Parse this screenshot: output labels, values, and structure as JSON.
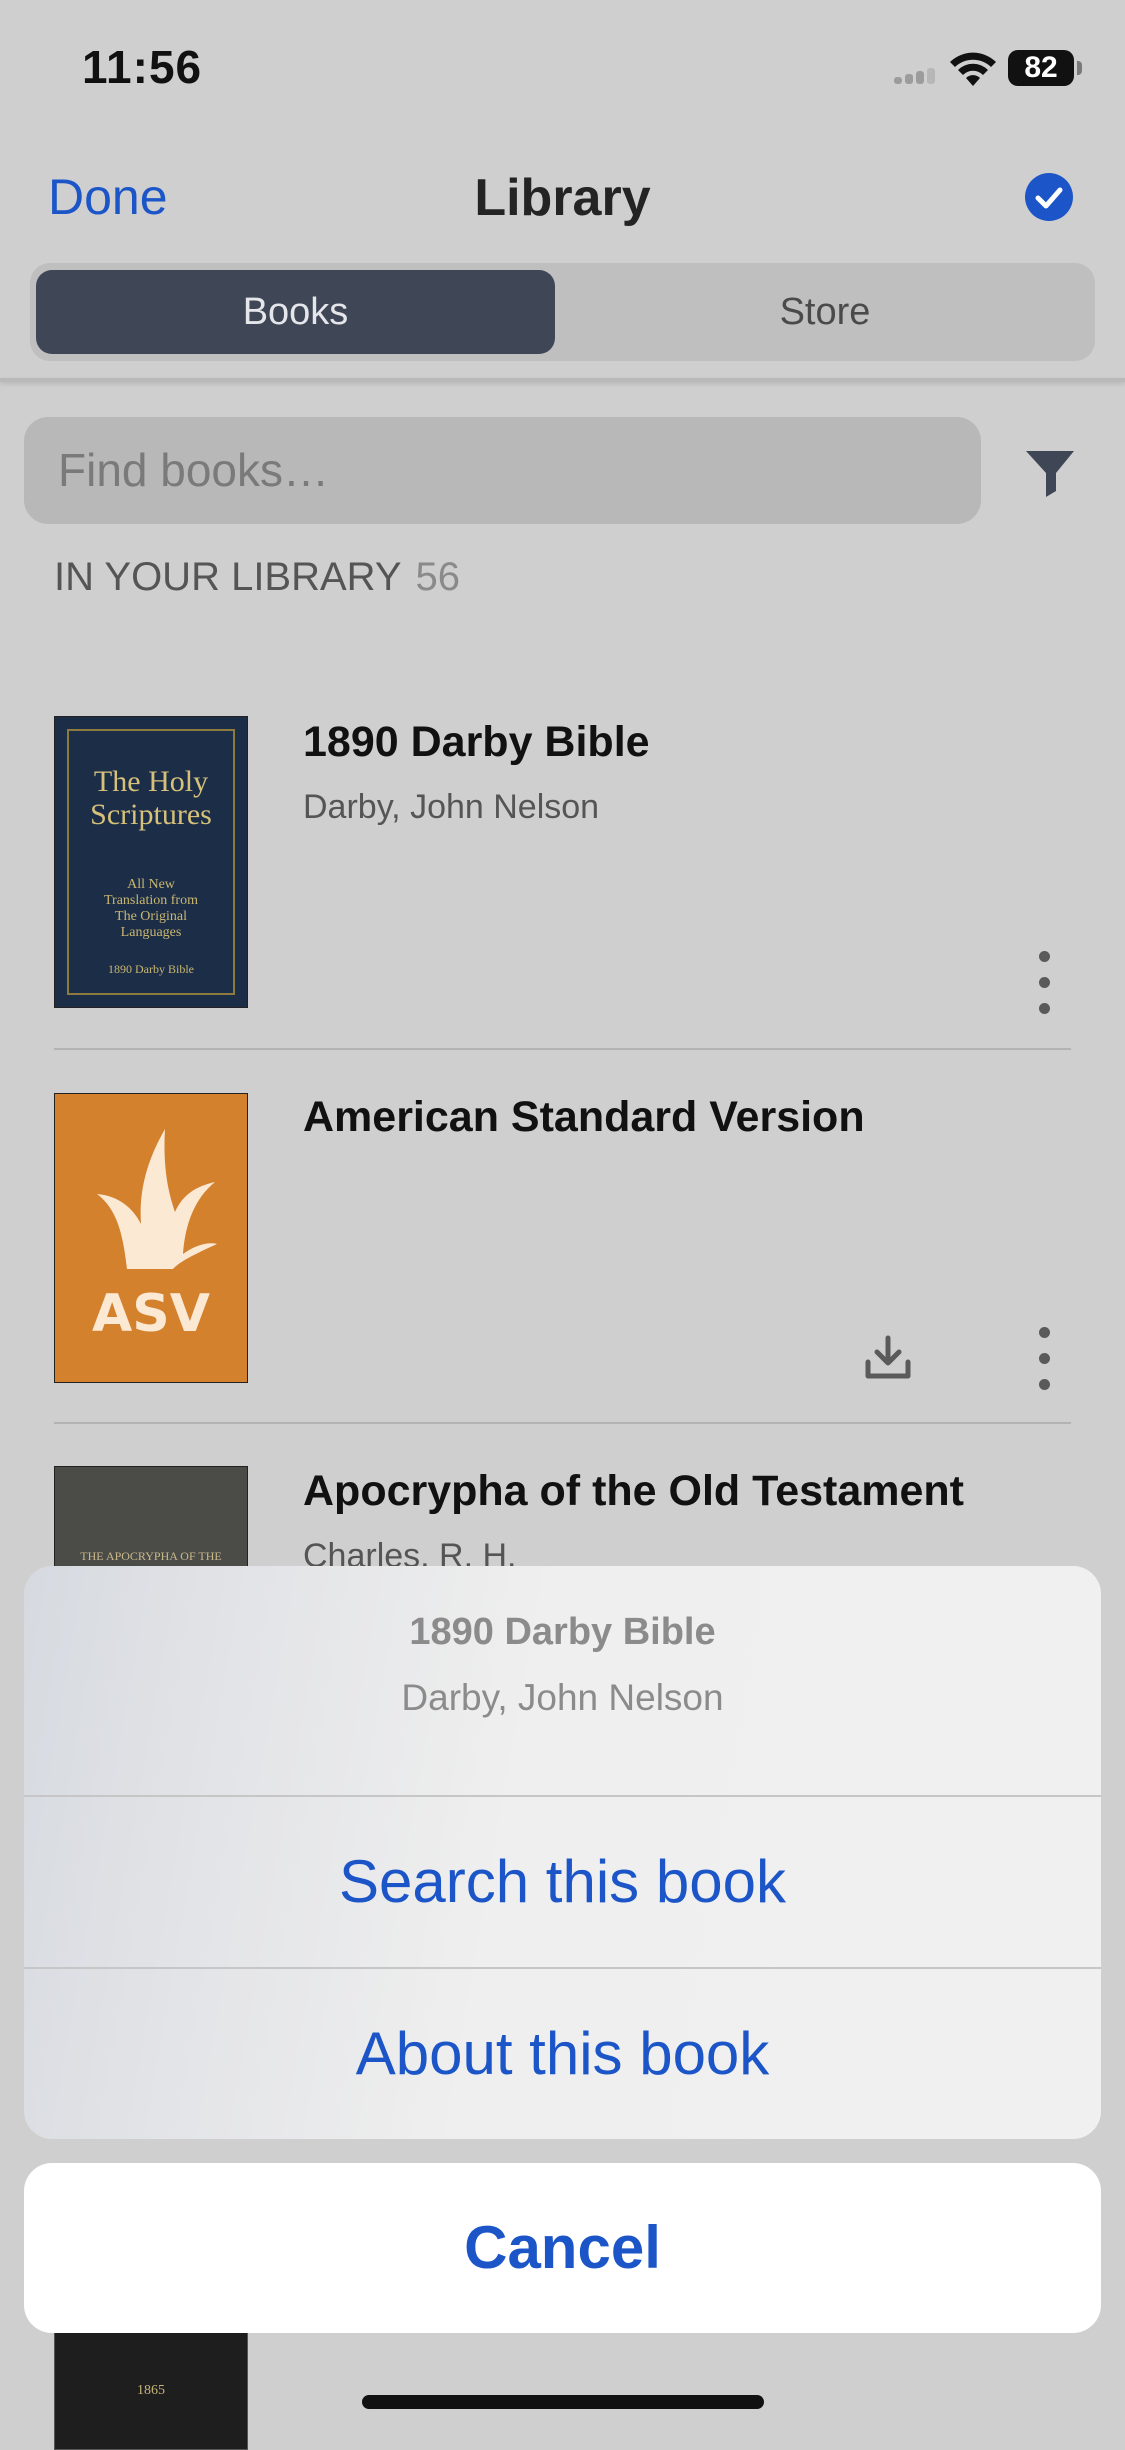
{
  "status_bar": {
    "time": "11:56",
    "battery": "82"
  },
  "nav": {
    "done_label": "Done",
    "title": "Library"
  },
  "segments": {
    "books": "Books",
    "store": "Store"
  },
  "search": {
    "placeholder": "Find books…"
  },
  "section": {
    "label": "IN YOUR LIBRARY",
    "count": "56"
  },
  "books": [
    {
      "title": "1890 Darby Bible",
      "author": "Darby, John Nelson",
      "cover": {
        "line1": "The Holy",
        "line2": "Scriptures",
        "line3": "All New",
        "line4": "Translation from",
        "line5": "The Original",
        "line6": "Languages",
        "line7": "1890 Darby Bible"
      }
    },
    {
      "title": "American Standard Version",
      "author": "",
      "cover": {
        "text": "ASV"
      }
    },
    {
      "title": "Apocrypha of the Old Testament",
      "author": "Charles, R. H.",
      "cover": {
        "text": "THE APOCRYPHA OF THE"
      }
    }
  ],
  "bottom_cover": {
    "text": "1865"
  },
  "action_sheet": {
    "title": "1890 Darby Bible",
    "subtitle": "Darby, John Nelson",
    "search_label": "Search this book",
    "about_label": "About this book",
    "cancel_label": "Cancel"
  },
  "colors": {
    "accent": "#1b55c8",
    "segment_active": "#3f4656",
    "asv_orange": "#d4812e",
    "darby_navy": "#1c2e47"
  },
  "icons": [
    "wifi-icon",
    "battery-icon",
    "checkmark-circle-icon",
    "filter-icon",
    "download-icon",
    "more-vertical-icon"
  ]
}
